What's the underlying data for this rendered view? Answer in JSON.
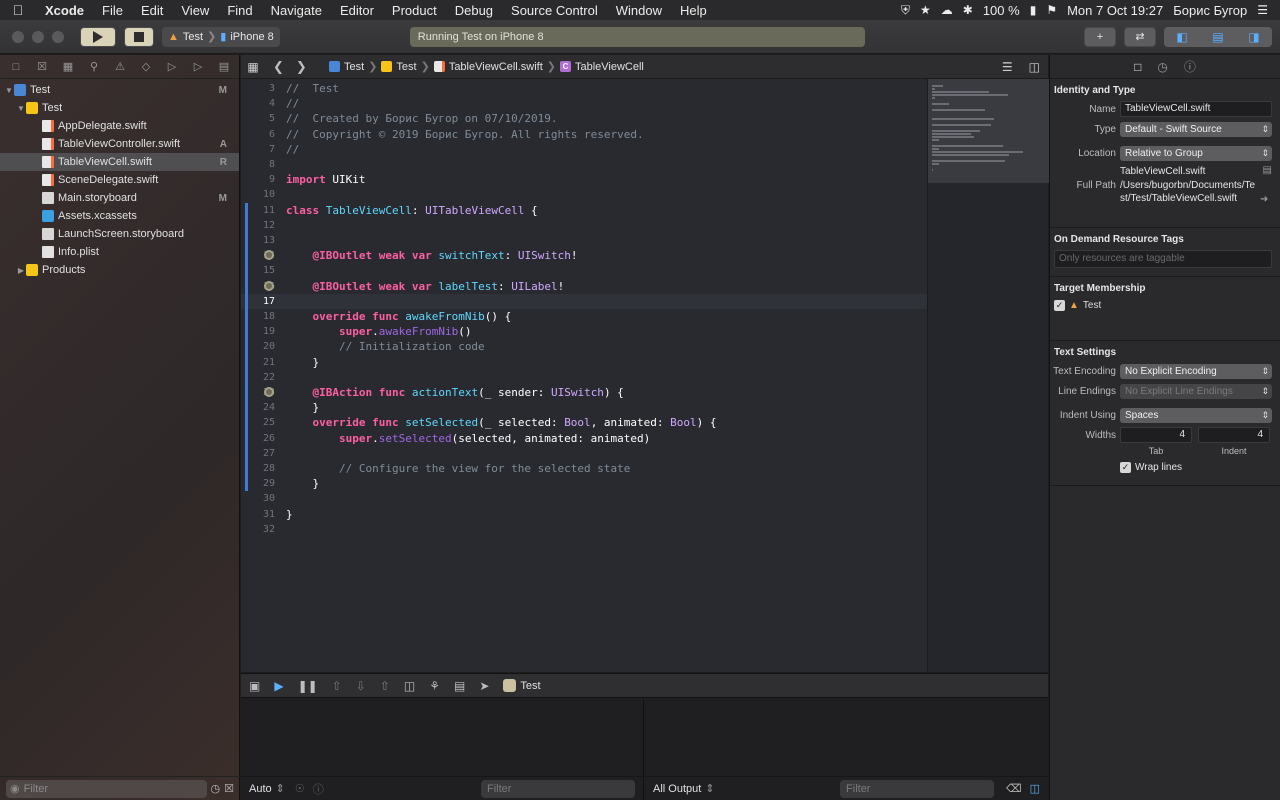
{
  "menubar": {
    "app_name": "Xcode",
    "items": [
      "File",
      "Edit",
      "View",
      "Find",
      "Navigate",
      "Editor",
      "Product",
      "Debug",
      "Source Control",
      "Window",
      "Help"
    ],
    "battery": "100 %",
    "datetime": "Mon 7 Oct  19:27",
    "user": "Борис Бугор"
  },
  "toolbar": {
    "scheme": "Test",
    "device": "iPhone 8",
    "activity": "Running Test on iPhone 8"
  },
  "navigator": {
    "items": [
      {
        "label": "Test",
        "badge": "M"
      },
      {
        "label": "Test",
        "badge": ""
      },
      {
        "label": "AppDelegate.swift",
        "badge": ""
      },
      {
        "label": "TableViewController.swift",
        "badge": "A"
      },
      {
        "label": "TableViewCell.swift",
        "badge": "R"
      },
      {
        "label": "SceneDelegate.swift",
        "badge": ""
      },
      {
        "label": "Main.storyboard",
        "badge": "M"
      },
      {
        "label": "Assets.xcassets",
        "badge": ""
      },
      {
        "label": "LaunchScreen.storyboard",
        "badge": ""
      },
      {
        "label": "Info.plist",
        "badge": ""
      },
      {
        "label": "Products",
        "badge": ""
      }
    ],
    "filter_placeholder": "Filter"
  },
  "jumpbar": {
    "crumbs": [
      "Test",
      "Test",
      "TableViewCell.swift",
      "TableViewCell"
    ]
  },
  "code": {
    "lines": [
      {
        "n": "3",
        "tokens": [
          [
            "c",
            "//  Test"
          ]
        ]
      },
      {
        "n": "4",
        "tokens": [
          [
            "c",
            "//"
          ]
        ]
      },
      {
        "n": "5",
        "tokens": [
          [
            "c",
            "//  Created by Борис Бугор on 07/10/2019."
          ]
        ]
      },
      {
        "n": "6",
        "tokens": [
          [
            "c",
            "//  Copyright © 2019 Борис Бугор. All rights reserved."
          ]
        ]
      },
      {
        "n": "7",
        "tokens": [
          [
            "c",
            "//"
          ]
        ]
      },
      {
        "n": "8",
        "tokens": []
      },
      {
        "n": "9",
        "tokens": [
          [
            "k",
            "import"
          ],
          [
            "p",
            " UIKit"
          ]
        ]
      },
      {
        "n": "10",
        "tokens": []
      },
      {
        "n": "11",
        "tokens": [
          [
            "k",
            "class"
          ],
          [
            "p",
            " "
          ],
          [
            "d",
            "TableViewCell"
          ],
          [
            "p",
            ": "
          ],
          [
            "t",
            "UITableViewCell"
          ],
          [
            "p",
            " {"
          ]
        ]
      },
      {
        "n": "12",
        "tokens": []
      },
      {
        "n": "13",
        "tokens": []
      },
      {
        "n": "14",
        "tokens": [
          [
            "p",
            "    "
          ],
          [
            "k",
            "@IBOutlet"
          ],
          [
            "p",
            " "
          ],
          [
            "k",
            "weak"
          ],
          [
            "p",
            " "
          ],
          [
            "k",
            "var"
          ],
          [
            "p",
            " "
          ],
          [
            "d",
            "switchText"
          ],
          [
            "p",
            ": "
          ],
          [
            "t",
            "UISwitch"
          ],
          [
            "p",
            "!"
          ]
        ],
        "outlet": true
      },
      {
        "n": "15",
        "tokens": []
      },
      {
        "n": "16",
        "tokens": [
          [
            "p",
            "    "
          ],
          [
            "k",
            "@IBOutlet"
          ],
          [
            "p",
            " "
          ],
          [
            "k",
            "weak"
          ],
          [
            "p",
            " "
          ],
          [
            "k",
            "var"
          ],
          [
            "p",
            " "
          ],
          [
            "d",
            "labelTest"
          ],
          [
            "p",
            ": "
          ],
          [
            "t",
            "UILabel"
          ],
          [
            "p",
            "!"
          ]
        ],
        "outlet": true
      },
      {
        "n": "17",
        "tokens": [],
        "current": true
      },
      {
        "n": "18",
        "tokens": [
          [
            "p",
            "    "
          ],
          [
            "k",
            "override"
          ],
          [
            "p",
            " "
          ],
          [
            "k",
            "func"
          ],
          [
            "p",
            " "
          ],
          [
            "d",
            "awakeFromNib"
          ],
          [
            "p",
            "() {"
          ]
        ]
      },
      {
        "n": "19",
        "tokens": [
          [
            "p",
            "        "
          ],
          [
            "k",
            "super"
          ],
          [
            "p",
            "."
          ],
          [
            "m",
            "awakeFromNib"
          ],
          [
            "p",
            "()"
          ]
        ]
      },
      {
        "n": "20",
        "tokens": [
          [
            "p",
            "        "
          ],
          [
            "c",
            "// Initialization code"
          ]
        ]
      },
      {
        "n": "21",
        "tokens": [
          [
            "p",
            "    }"
          ]
        ]
      },
      {
        "n": "22",
        "tokens": []
      },
      {
        "n": "23",
        "tokens": [
          [
            "p",
            "    "
          ],
          [
            "k",
            "@IBAction"
          ],
          [
            "p",
            " "
          ],
          [
            "k",
            "func"
          ],
          [
            "p",
            " "
          ],
          [
            "d",
            "actionText"
          ],
          [
            "p",
            "(_ sender: "
          ],
          [
            "t",
            "UISwitch"
          ],
          [
            "p",
            ") {"
          ]
        ],
        "outlet": true
      },
      {
        "n": "24",
        "tokens": [
          [
            "p",
            "    }"
          ]
        ]
      },
      {
        "n": "25",
        "tokens": [
          [
            "p",
            "    "
          ],
          [
            "k",
            "override"
          ],
          [
            "p",
            " "
          ],
          [
            "k",
            "func"
          ],
          [
            "p",
            " "
          ],
          [
            "d",
            "setSelected"
          ],
          [
            "p",
            "(_ selected: "
          ],
          [
            "t",
            "Bool"
          ],
          [
            "p",
            ", animated: "
          ],
          [
            "t",
            "Bool"
          ],
          [
            "p",
            ") {"
          ]
        ]
      },
      {
        "n": "26",
        "tokens": [
          [
            "p",
            "        "
          ],
          [
            "k",
            "super"
          ],
          [
            "p",
            "."
          ],
          [
            "m",
            "setSelected"
          ],
          [
            "p",
            "(selected, animated: animated)"
          ]
        ]
      },
      {
        "n": "27",
        "tokens": []
      },
      {
        "n": "28",
        "tokens": [
          [
            "p",
            "        "
          ],
          [
            "c",
            "// Configure the view for the selected state"
          ]
        ]
      },
      {
        "n": "29",
        "tokens": [
          [
            "p",
            "    }"
          ]
        ]
      },
      {
        "n": "30",
        "tokens": []
      },
      {
        "n": "31",
        "tokens": [
          [
            "p",
            "}"
          ]
        ]
      },
      {
        "n": "32",
        "tokens": []
      }
    ]
  },
  "debug": {
    "target": "Test",
    "scope": "Auto",
    "output": "All Output",
    "filter_placeholder": "Filter"
  },
  "inspector": {
    "identity_title": "Identity and Type",
    "name_label": "Name",
    "name_value": "TableViewCell.swift",
    "type_label": "Type",
    "type_value": "Default - Swift Source",
    "location_label": "Location",
    "location_value": "Relative to Group",
    "location_file": "TableViewCell.swift",
    "fullpath_label": "Full Path",
    "fullpath_value": "/Users/bugorbn/Documents/Test/Test/TableViewCell.swift",
    "odr_title": "On Demand Resource Tags",
    "odr_placeholder": "Only resources are taggable",
    "target_title": "Target Membership",
    "target_name": "Test",
    "text_title": "Text Settings",
    "encoding_label": "Text Encoding",
    "encoding_value": "No Explicit Encoding",
    "line_endings_label": "Line Endings",
    "line_endings_value": "No Explicit Line Endings",
    "indent_label": "Indent Using",
    "indent_value": "Spaces",
    "widths_label": "Widths",
    "tab_width": "4",
    "indent_width": "4",
    "tab_caption": "Tab",
    "indent_caption": "Indent",
    "wrap_label": "Wrap lines"
  }
}
